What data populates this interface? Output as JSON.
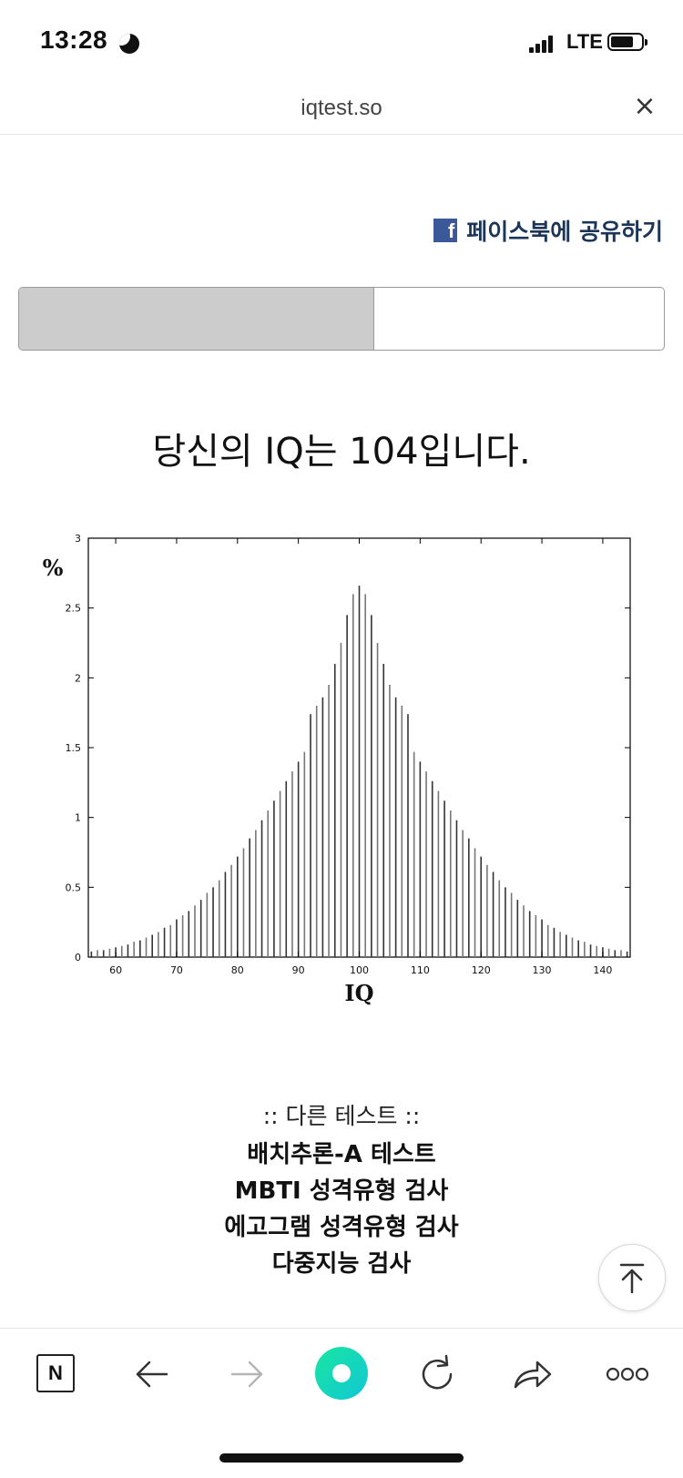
{
  "status_bar": {
    "time": "13:28",
    "network": "LTE"
  },
  "browser": {
    "url": "iqtest.so"
  },
  "share": {
    "label": "페이스북에 공유하기",
    "icon": "facebook-icon",
    "icon_letter": "f"
  },
  "progress": {
    "fraction": 0.55
  },
  "result": {
    "text": "당신의 IQ는 104입니다."
  },
  "chart_data": {
    "type": "bar",
    "xlabel": "IQ",
    "ylabel": "%",
    "xlim": [
      55.5,
      144.5
    ],
    "ylim": [
      0,
      3
    ],
    "xticks": [
      60,
      70,
      80,
      90,
      100,
      110,
      120,
      130,
      140
    ],
    "yticks": [
      "0",
      "0.5",
      "1",
      "1.5",
      "2",
      "2.5",
      "3"
    ],
    "distribution": {
      "mean": 100,
      "sd": 15
    },
    "x": [
      56,
      57,
      58,
      59,
      60,
      61,
      62,
      63,
      64,
      65,
      66,
      67,
      68,
      69,
      70,
      71,
      72,
      73,
      74,
      75,
      76,
      77,
      78,
      79,
      80,
      81,
      82,
      83,
      84,
      85,
      86,
      87,
      88,
      89,
      90,
      91,
      92,
      93,
      94,
      95,
      96,
      97,
      98,
      99,
      100,
      101,
      102,
      103,
      104,
      105,
      106,
      107,
      108,
      109,
      110,
      111,
      112,
      113,
      114,
      115,
      116,
      117,
      118,
      119,
      120,
      121,
      122,
      123,
      124,
      125,
      126,
      127,
      128,
      129,
      130,
      131,
      132,
      133,
      134,
      135,
      136,
      137,
      138,
      139,
      140,
      141,
      142,
      143,
      144
    ],
    "values": [
      0.04,
      0.05,
      0.05,
      0.06,
      0.07,
      0.08,
      0.09,
      0.11,
      0.12,
      0.14,
      0.16,
      0.18,
      0.21,
      0.23,
      0.27,
      0.3,
      0.33,
      0.37,
      0.41,
      0.46,
      0.5,
      0.55,
      0.61,
      0.66,
      0.72,
      0.78,
      0.85,
      0.91,
      0.98,
      1.05,
      1.12,
      1.19,
      1.26,
      1.33,
      1.4,
      1.47,
      1.74,
      1.8,
      1.86,
      1.95,
      2.1,
      2.25,
      2.45,
      2.6,
      2.66,
      2.6,
      2.45,
      2.25,
      2.1,
      1.95,
      1.86,
      1.8,
      1.74,
      1.47,
      1.4,
      1.33,
      1.26,
      1.19,
      1.12,
      1.05,
      0.98,
      0.91,
      0.85,
      0.78,
      0.72,
      0.66,
      0.61,
      0.55,
      0.5,
      0.46,
      0.41,
      0.37,
      0.33,
      0.3,
      0.27,
      0.23,
      0.21,
      0.18,
      0.16,
      0.14,
      0.12,
      0.11,
      0.09,
      0.08,
      0.07,
      0.06,
      0.05,
      0.05,
      0.04
    ],
    "grid": false
  },
  "other_tests": {
    "title": ":: 다른 테스트 ::",
    "links": [
      "배치추론-A 테스트",
      "MBTI 성격유형 검사",
      "에고그램 성격유형 검사",
      "다중지능 검사"
    ]
  },
  "icons": {
    "scroll_top": "arrow-up-to-top-icon",
    "back": "arrow-left-icon",
    "forward": "arrow-right-icon",
    "reload": "reload-icon",
    "share": "share-icon",
    "more": "more-icon",
    "naver": "naver-n-icon",
    "home": "home-icon"
  },
  "toolbar": {
    "naver_letter": "N"
  }
}
